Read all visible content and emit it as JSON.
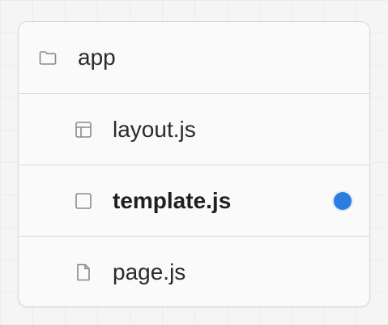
{
  "file_tree": {
    "folder": {
      "label": "app",
      "icon": "folder-icon"
    },
    "files": [
      {
        "label": "layout.js",
        "icon": "layout-icon",
        "highlighted": false
      },
      {
        "label": "template.js",
        "icon": "square-icon",
        "highlighted": true
      },
      {
        "label": "page.js",
        "icon": "file-icon",
        "highlighted": false
      }
    ]
  },
  "colors": {
    "accent_dot": "#2a7de1",
    "border": "#d9d9d9",
    "icon_stroke": "#8a8a8a",
    "text": "#2b2b2b"
  }
}
